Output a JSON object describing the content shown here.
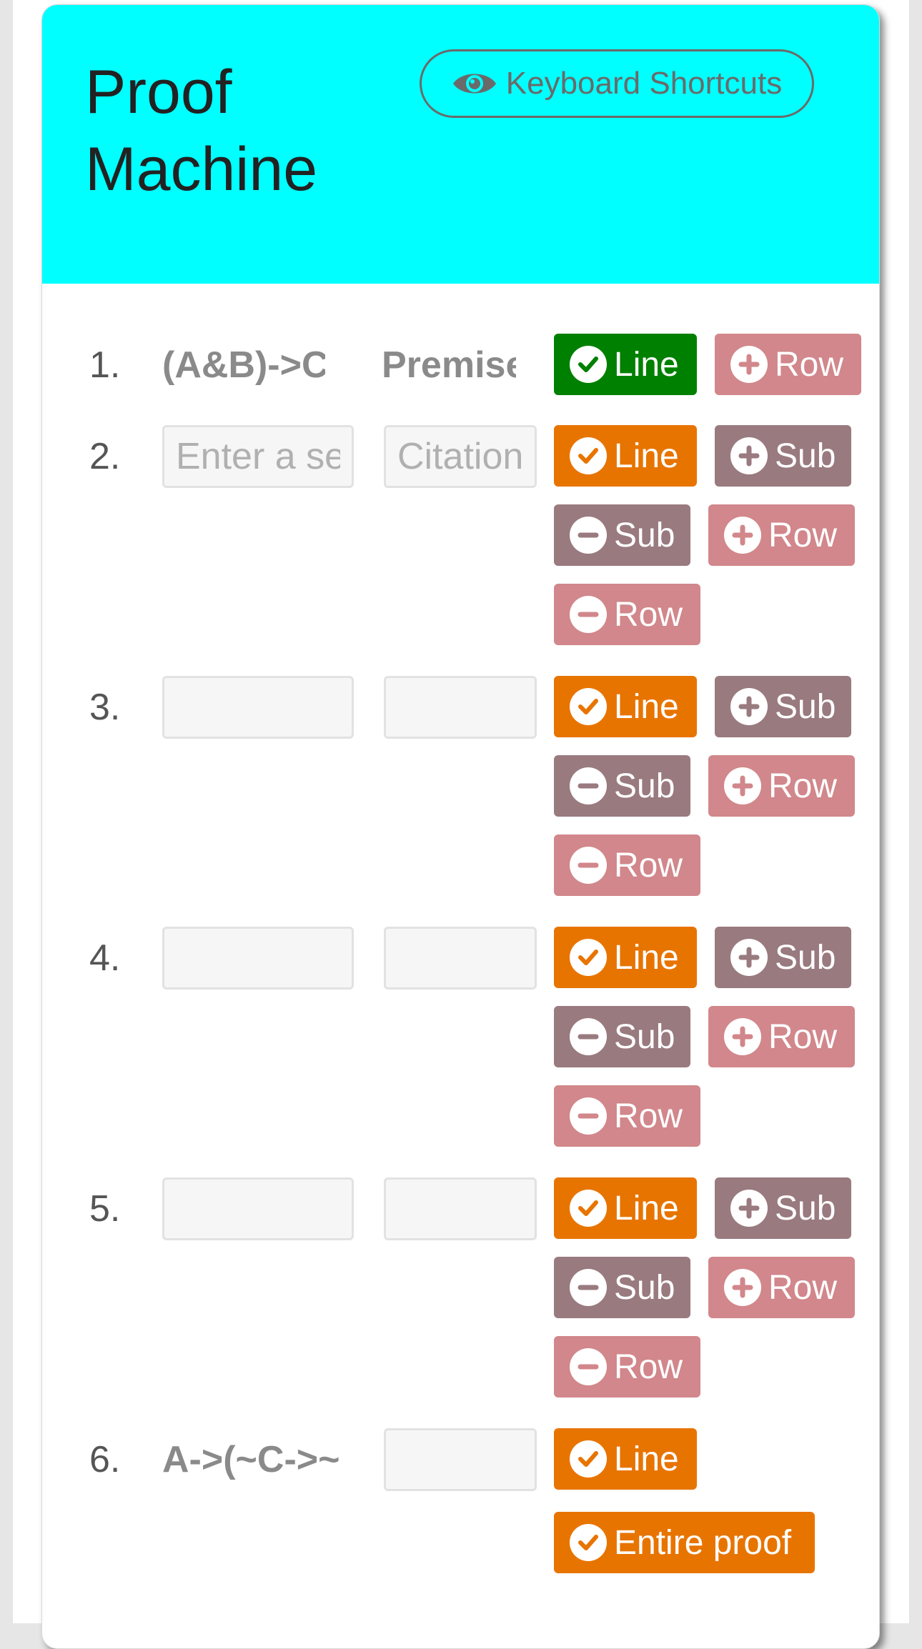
{
  "header": {
    "title": "Proof Machine",
    "shortcuts_label": "Keyboard Shortcuts"
  },
  "colors": {
    "header_bg": "#00ffff",
    "check_ok": "#008000",
    "check": "#e87400",
    "sub": "#997a7f",
    "row": "#d1878b"
  },
  "proof": {
    "rows": [
      {
        "number": "1.",
        "sentence": "(A&B)->C",
        "citation": "Premise"
      },
      {
        "number": "2.",
        "sentence_placeholder": "Enter a sentence",
        "citation_placeholder": "Citation"
      },
      {
        "number": "3."
      },
      {
        "number": "4."
      },
      {
        "number": "5."
      },
      {
        "number": "6.",
        "sentence": "A->(~C->~B)"
      }
    ]
  },
  "buttons": {
    "line": "Line",
    "add_row": "Row",
    "add_sub": "Sub",
    "remove_sub": "Sub",
    "remove_row": "Row",
    "entire_proof": "Entire proof"
  }
}
